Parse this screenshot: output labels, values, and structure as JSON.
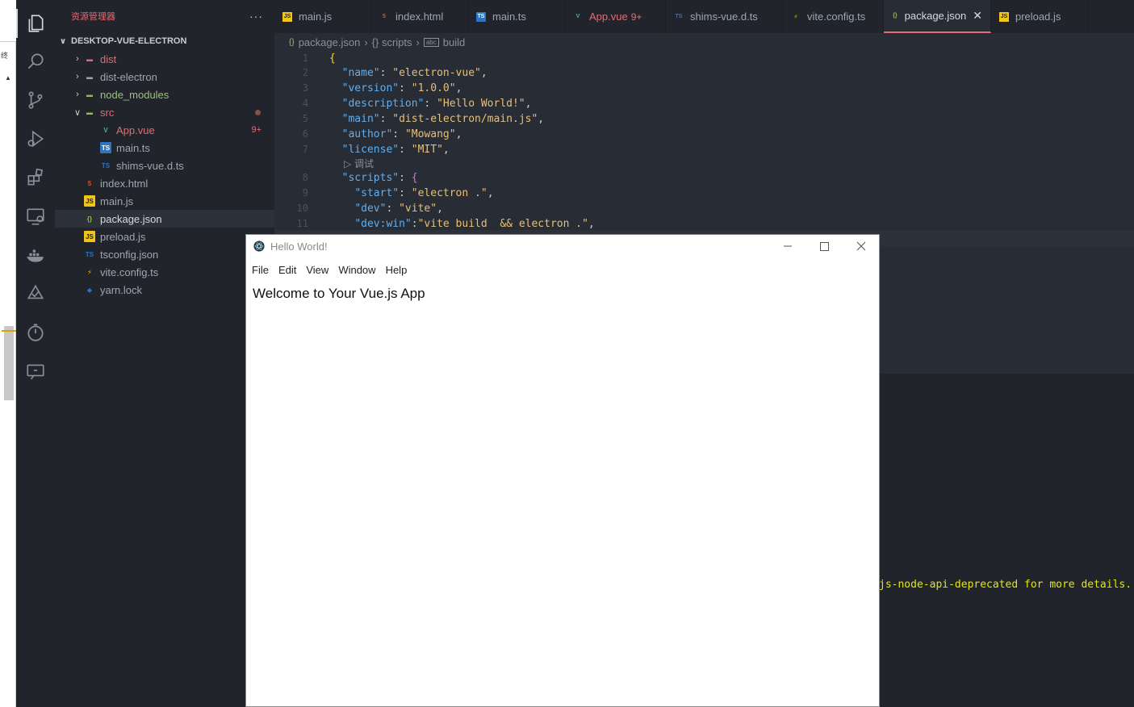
{
  "side_window": {
    "glyph": "终"
  },
  "activity_bar": {
    "icons": [
      "explorer-icon",
      "search-icon",
      "source-control-icon",
      "run-debug-icon",
      "extensions-icon",
      "remote-explorer-icon",
      "docker-icon",
      "vitest-icon",
      "timeline-icon",
      "live-share-icon"
    ]
  },
  "sidebar": {
    "title": "资源管理器",
    "more": "···",
    "project": "DESKTOP-VUE-ELECTRON",
    "items": [
      {
        "label": "dist",
        "kind": "folder",
        "color": "#e06c75"
      },
      {
        "label": "dist-electron",
        "kind": "folder",
        "color": "#9da5b4"
      },
      {
        "label": "node_modules",
        "kind": "folder",
        "color": "#98c379"
      },
      {
        "label": "src",
        "kind": "folder-open",
        "color": "#e06c75"
      },
      {
        "label": "App.vue",
        "badge": "9+",
        "color": "#e06c75"
      },
      {
        "label": "main.ts",
        "color": "#9da5b4"
      },
      {
        "label": "shims-vue.d.ts",
        "color": "#9da5b4"
      },
      {
        "label": "index.html",
        "color": "#9da5b4"
      },
      {
        "label": "main.js",
        "color": "#9da5b4"
      },
      {
        "label": "package.json",
        "color": "#d7dae0"
      },
      {
        "label": "preload.js",
        "color": "#9da5b4"
      },
      {
        "label": "tsconfig.json",
        "color": "#9da5b4"
      },
      {
        "label": "vite.config.ts",
        "color": "#9da5b4"
      },
      {
        "label": "yarn.lock",
        "color": "#9da5b4"
      }
    ]
  },
  "tabs": [
    {
      "label": "main.js",
      "icon": "JS"
    },
    {
      "label": "index.html",
      "icon": "5"
    },
    {
      "label": "main.ts",
      "icon": "TS"
    },
    {
      "label": "App.vue",
      "icon": "V",
      "badge": "9+"
    },
    {
      "label": "shims-vue.d.ts",
      "icon": "TS"
    },
    {
      "label": "vite.config.ts",
      "icon": "⚡"
    },
    {
      "label": "package.json",
      "icon": "{}",
      "close": "✕"
    },
    {
      "label": "preload.js",
      "icon": "JS"
    }
  ],
  "breadcrumb": {
    "file": "package.json",
    "section": "{} scripts",
    "leaf": "build"
  },
  "editor": {
    "lines": [
      {
        "n": "1",
        "key": "",
        "value": "",
        "open": "{"
      },
      {
        "n": "2",
        "key": "\"name\"",
        "value": "\"electron-vue\""
      },
      {
        "n": "3",
        "key": "\"version\"",
        "value": "\"1.0.0\""
      },
      {
        "n": "4",
        "key": "\"description\"",
        "value": "\"Hello World!\""
      },
      {
        "n": "5",
        "key": "\"main\"",
        "value": "\"dist-electron/main.js\""
      },
      {
        "n": "6",
        "key": "\"author\"",
        "value": "\"Mowang\""
      },
      {
        "n": "7",
        "key": "\"license\"",
        "value": "\"MIT\""
      },
      {
        "n": "8",
        "key": "\"scripts\"",
        "value": "{"
      },
      {
        "n": "9",
        "key": "\"start\"",
        "value": "\"electron .\""
      },
      {
        "n": "10",
        "key": "\"dev\"",
        "value": "\"vite\""
      },
      {
        "n": "11",
        "key": "\"dev:win\"",
        "value": "\"vite build  && electron .\""
      }
    ],
    "codelens": "▷ 调试"
  },
  "terminal": {
    "text": "js-node-api-deprecated for more details."
  },
  "app_window": {
    "title": "Hello World!",
    "menu": [
      "File",
      "Edit",
      "View",
      "Window",
      "Help"
    ],
    "heading": "Welcome to Your Vue.js App"
  }
}
